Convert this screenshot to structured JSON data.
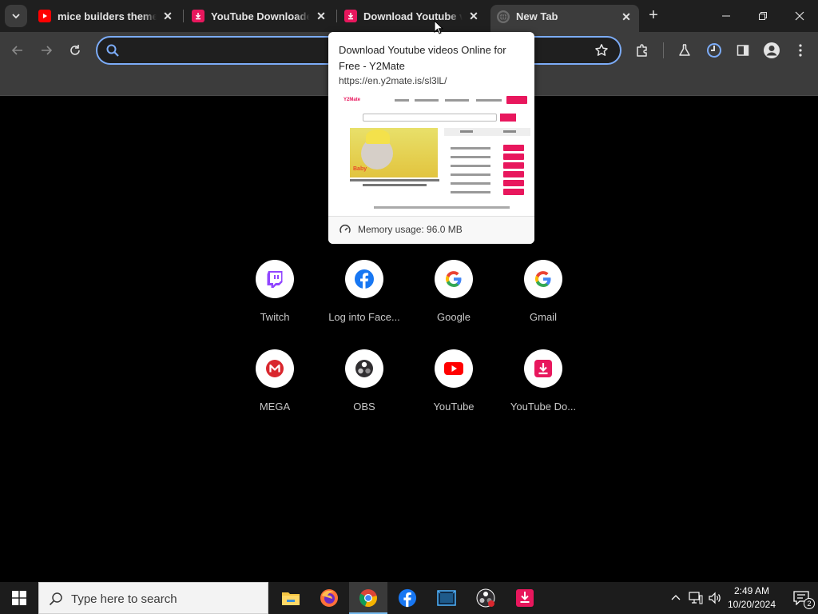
{
  "tabs": [
    {
      "title": "mice builders theme s",
      "favicon": "youtube-icon",
      "active": false
    },
    {
      "title": "YouTube Downloader",
      "favicon": "y2mate-icon",
      "active": false
    },
    {
      "title": "Download Youtube vi",
      "favicon": "y2mate-icon",
      "active": false
    },
    {
      "title": "New Tab",
      "favicon": "chrome-globe-icon",
      "active": true
    }
  ],
  "omnibox": {
    "value": "",
    "placeholder": ""
  },
  "hovercard": {
    "title": "Download Youtube videos Online for Free - Y2Mate",
    "url": "https://en.y2mate.is/sl3lL/",
    "memory": "Memory usage: 96.0 MB",
    "preview": {
      "logo": "Y2Mate",
      "thumb_text": "Baby"
    }
  },
  "shortcuts": [
    {
      "label": "Twitch",
      "icon": "twitch-icon"
    },
    {
      "label": "Log into Face...",
      "icon": "facebook-icon"
    },
    {
      "label": "Google",
      "icon": "google-icon"
    },
    {
      "label": "Gmail",
      "icon": "google-icon"
    },
    {
      "label": "MEGA",
      "icon": "mega-icon"
    },
    {
      "label": "OBS",
      "icon": "obs-icon"
    },
    {
      "label": "YouTube",
      "icon": "youtube-icon"
    },
    {
      "label": "YouTube Do...",
      "icon": "y2mate-icon"
    }
  ],
  "taskbar": {
    "search_placeholder": "Type here to search",
    "apps": [
      "file-explorer-icon",
      "firefox-icon",
      "chrome-icon",
      "facebook-icon",
      "video-editor-icon",
      "obs-icon",
      "y2mate-icon"
    ],
    "time": "2:49 AM",
    "date": "10/20/2024",
    "notification_count": "2"
  },
  "colors": {
    "accent_pink": "#e8175d",
    "youtube_red": "#ff0000",
    "twitch_purple": "#9146ff",
    "facebook_blue": "#1877f2",
    "omnibox_focus": "#7cacf8"
  }
}
